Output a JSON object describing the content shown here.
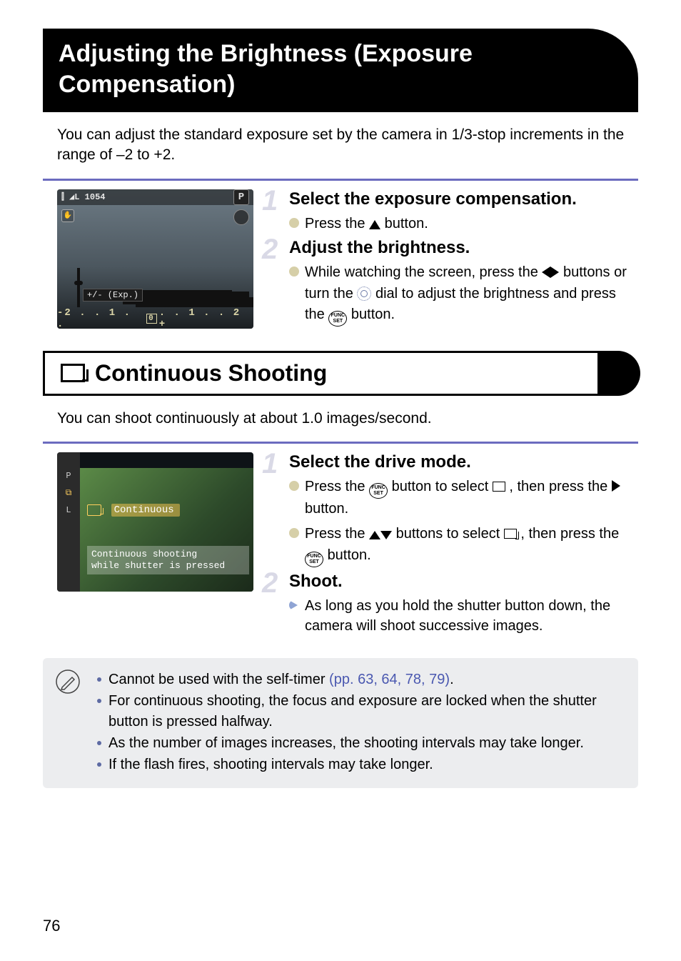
{
  "page_number": "76",
  "section1": {
    "title": "Adjusting the Brightness (Exposure Compensation)",
    "intro": "You can adjust the standard exposure set by the camera in 1/3-stop increments in the range of –2 to +2.",
    "lcd": {
      "top_left": "⫿ ◢L 1054",
      "mode_badge": "P",
      "exp_label": "+/- (Exp.)",
      "scale_left": "-2 . . 1 . .",
      "scale_zero": "0",
      "scale_right": ". . 1 . . 2 +"
    },
    "steps": [
      {
        "num": "1",
        "title": "Select the exposure compensation.",
        "bullets": [
          {
            "pre": "Press the ",
            "post": " button."
          }
        ]
      },
      {
        "num": "2",
        "title": "Adjust the brightness.",
        "bullets": [
          {
            "pre": "While watching the screen, press the ",
            "mid1": " buttons or turn the ",
            "mid2": " dial to adjust the brightness and press the ",
            "post": " button."
          }
        ]
      }
    ]
  },
  "section2": {
    "title": "Continuous Shooting",
    "intro": "You can shoot continuously at about 1.0 images/second.",
    "lcd": {
      "menu_label": "Continuous",
      "hint_line1": "Continuous shooting",
      "hint_line2": "while shutter is pressed",
      "left_items": [
        "",
        "",
        "P",
        "⧉",
        "L",
        ""
      ]
    },
    "steps": [
      {
        "num": "1",
        "title": "Select the drive mode.",
        "bullets": [
          {
            "pre": "Press the ",
            "mid1": " button to select ",
            "mid2": ", then press the ",
            "post": " button."
          },
          {
            "pre": "Press the ",
            "mid1": " buttons to select ",
            "mid2": ", then press the ",
            "post": " button."
          }
        ]
      },
      {
        "num": "2",
        "title": "Shoot.",
        "bullets": [
          {
            "text": "As long as you hold the shutter button down, the camera will shoot successive images."
          }
        ]
      }
    ],
    "notes": {
      "n1_pre": "Cannot be used with the self-timer ",
      "n1_link": "(pp. 63, 64, 78, 79)",
      "n1_post": ".",
      "n2": "For continuous shooting, the focus and exposure are locked when the shutter button is pressed halfway.",
      "n3": "As the number of images increases, the shooting intervals may take longer.",
      "n4": "If the flash fires, shooting intervals may take longer."
    }
  }
}
